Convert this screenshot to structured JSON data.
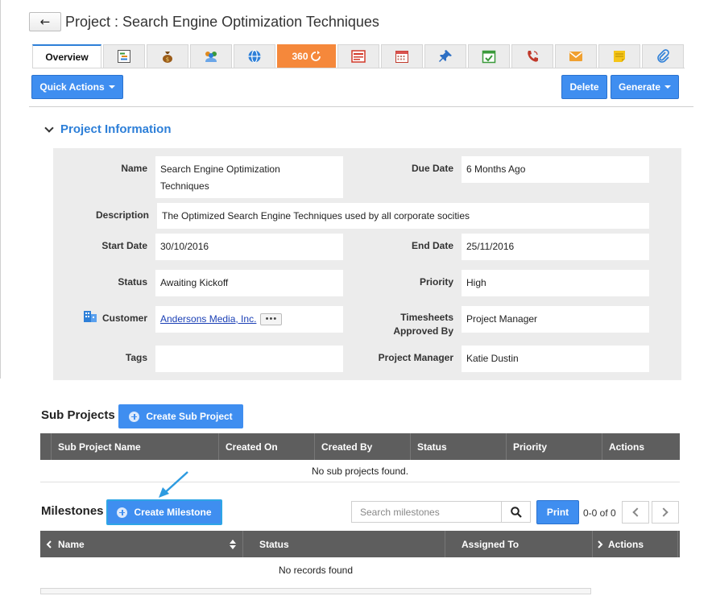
{
  "header": {
    "back_icon": "←",
    "title": "Project : Search Engine Optimization Techniques"
  },
  "tabs": [
    {
      "label": "Overview",
      "icon": "overview"
    },
    {
      "label": "",
      "icon": "gantt-icon"
    },
    {
      "label": "",
      "icon": "money-bag-icon"
    },
    {
      "label": "",
      "icon": "team-icon"
    },
    {
      "label": "",
      "icon": "globe-icon"
    },
    {
      "label": "360",
      "icon": "refresh-360-icon"
    },
    {
      "label": "",
      "icon": "invoice-icon"
    },
    {
      "label": "",
      "icon": "calendar-icon"
    },
    {
      "label": "",
      "icon": "pin-icon"
    },
    {
      "label": "",
      "icon": "task-check-icon"
    },
    {
      "label": "",
      "icon": "phone-icon"
    },
    {
      "label": "",
      "icon": "mail-icon"
    },
    {
      "label": "",
      "icon": "sticky-note-icon"
    },
    {
      "label": "",
      "icon": "paperclip-icon"
    }
  ],
  "toolbar": {
    "quick_actions": "Quick Actions",
    "delete": "Delete",
    "generate": "Generate"
  },
  "project_info": {
    "title": "Project Information",
    "name_label": "Name",
    "name_line1": "Search Engine Optimization",
    "name_line2": "Techniques",
    "due_date_label": "Due Date",
    "due_date": "6 Months Ago",
    "description_label": "Description",
    "description": "The Optimized Search Engine Techniques used by all corporate socities",
    "start_date_label": "Start Date",
    "start_date": "30/10/2016",
    "end_date_label": "End Date",
    "end_date": "25/11/2016",
    "status_label": "Status",
    "status": "Awaiting Kickoff",
    "priority_label": "Priority",
    "priority": "High",
    "customer_label": "Customer",
    "customer": "Andersons Media, Inc.",
    "more_label": "•••",
    "timesheets_label_1": "Timesheets",
    "timesheets_label_2": "Approved By",
    "timesheets": "Project Manager",
    "tags_label": "Tags",
    "tags": "",
    "pm_label": "Project Manager",
    "pm": "Katie Dustin"
  },
  "sub_projects": {
    "title": "Sub Projects",
    "create_button": "Create Sub Project",
    "columns": [
      "Sub Project Name",
      "Created On",
      "Created By",
      "Status",
      "Priority",
      "Actions"
    ],
    "empty": "No sub projects found."
  },
  "milestones": {
    "title": "Milestones",
    "create_button": "Create Milestone",
    "search_placeholder": "Search milestones",
    "print": "Print",
    "pager": "0-0 of 0",
    "columns": [
      "Name",
      "Status",
      "Assigned To",
      "Actions"
    ],
    "empty": "No records found"
  },
  "colors": {
    "accent": "#3f8ef0",
    "link": "#2d7fd8",
    "orange": "#f5883b",
    "header_bg": "#5e5e5e"
  }
}
